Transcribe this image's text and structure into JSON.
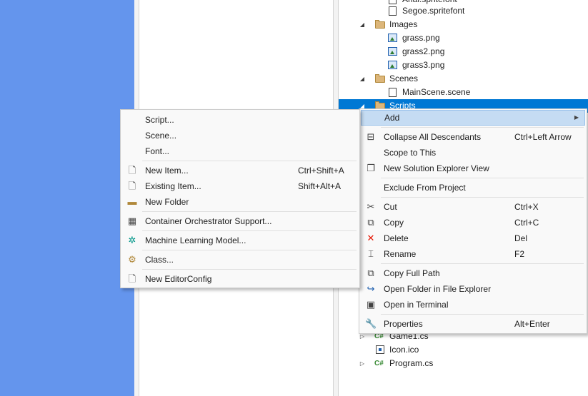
{
  "tree": {
    "rows": [
      {
        "label": "Arial.spritefont",
        "icon": "file",
        "indent": 2
      },
      {
        "label": "Segoe.spritefont",
        "icon": "file",
        "indent": 2
      },
      {
        "label": "Images",
        "icon": "folder",
        "indent": 1,
        "expanded": true
      },
      {
        "label": "grass.png",
        "icon": "image",
        "indent": 2
      },
      {
        "label": "grass2.png",
        "icon": "image",
        "indent": 2
      },
      {
        "label": "grass3.png",
        "icon": "image",
        "indent": 2
      },
      {
        "label": "Scenes",
        "icon": "folder",
        "indent": 1,
        "expanded": true
      },
      {
        "label": "MainScene.scene",
        "icon": "file",
        "indent": 2
      },
      {
        "label": "Scripts",
        "icon": "folder",
        "indent": 1,
        "expanded": true,
        "selected": true
      }
    ],
    "bottom_rows": [
      {
        "label": "Game1.cs",
        "icon": "csharp",
        "collapsed": true
      },
      {
        "label": "Icon.ico",
        "icon": "ico",
        "collapsed": false
      },
      {
        "label": "Program.cs",
        "icon": "csharp",
        "collapsed": true
      }
    ]
  },
  "context_menu": {
    "items": [
      {
        "label": "Add",
        "shortcut": "",
        "icon": "",
        "has_submenu": true,
        "highlighted": true
      },
      {
        "label": "Collapse All Descendants",
        "shortcut": "Ctrl+Left Arrow",
        "icon": "collapse-icon"
      },
      {
        "label": "Scope to This",
        "shortcut": "",
        "icon": ""
      },
      {
        "label": "New Solution Explorer View",
        "shortcut": "",
        "icon": "new-view-icon"
      },
      {
        "label": "Exclude From Project",
        "shortcut": "",
        "icon": ""
      },
      {
        "label": "Cut",
        "shortcut": "Ctrl+X",
        "icon": "scissors-icon"
      },
      {
        "label": "Copy",
        "shortcut": "Ctrl+C",
        "icon": "copy-icon"
      },
      {
        "label": "Delete",
        "shortcut": "Del",
        "icon": "delete-icon"
      },
      {
        "label": "Rename",
        "shortcut": "F2",
        "icon": "rename-icon"
      },
      {
        "label": "Copy Full Path",
        "shortcut": "",
        "icon": "copy-path-icon"
      },
      {
        "label": "Open Folder in File Explorer",
        "shortcut": "",
        "icon": "open-folder-icon"
      },
      {
        "label": "Open in Terminal",
        "shortcut": "",
        "icon": "terminal-icon"
      },
      {
        "label": "Properties",
        "shortcut": "Alt+Enter",
        "icon": "wrench-icon"
      }
    ]
  },
  "sub_menu": {
    "items": [
      {
        "label": "Script...",
        "shortcut": "",
        "icon": ""
      },
      {
        "label": "Scene...",
        "shortcut": "",
        "icon": ""
      },
      {
        "label": "Font...",
        "shortcut": "",
        "icon": ""
      },
      {
        "label": "New Item...",
        "shortcut": "Ctrl+Shift+A",
        "icon": "new-item-icon"
      },
      {
        "label": "Existing Item...",
        "shortcut": "Shift+Alt+A",
        "icon": "existing-item-icon"
      },
      {
        "label": "New Folder",
        "shortcut": "",
        "icon": "new-folder-icon"
      },
      {
        "label": "Container Orchestrator Support...",
        "shortcut": "",
        "icon": "container-icon"
      },
      {
        "label": "Machine Learning Model...",
        "shortcut": "",
        "icon": "ml-model-icon"
      },
      {
        "label": "Class...",
        "shortcut": "",
        "icon": "class-icon"
      },
      {
        "label": "New EditorConfig",
        "shortcut": "",
        "icon": "editorconfig-icon"
      }
    ]
  },
  "colors": {
    "left_pane": "#6495ed",
    "selection": "#0078d4",
    "menu_highlight": "#c5dcf3"
  }
}
